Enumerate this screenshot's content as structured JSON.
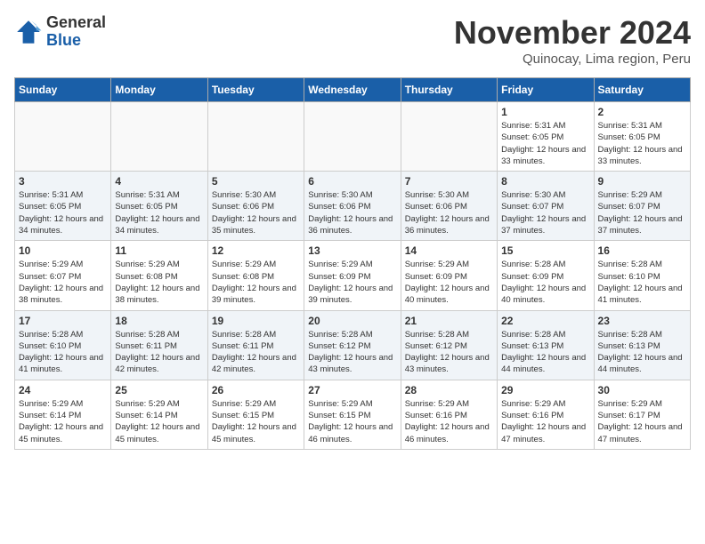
{
  "logo": {
    "general": "General",
    "blue": "Blue"
  },
  "header": {
    "month": "November 2024",
    "location": "Quinocay, Lima region, Peru"
  },
  "weekdays": [
    "Sunday",
    "Monday",
    "Tuesday",
    "Wednesday",
    "Thursday",
    "Friday",
    "Saturday"
  ],
  "weeks": [
    [
      {
        "day": "",
        "info": ""
      },
      {
        "day": "",
        "info": ""
      },
      {
        "day": "",
        "info": ""
      },
      {
        "day": "",
        "info": ""
      },
      {
        "day": "",
        "info": ""
      },
      {
        "day": "1",
        "info": "Sunrise: 5:31 AM\nSunset: 6:05 PM\nDaylight: 12 hours and 33 minutes."
      },
      {
        "day": "2",
        "info": "Sunrise: 5:31 AM\nSunset: 6:05 PM\nDaylight: 12 hours and 33 minutes."
      }
    ],
    [
      {
        "day": "3",
        "info": "Sunrise: 5:31 AM\nSunset: 6:05 PM\nDaylight: 12 hours and 34 minutes."
      },
      {
        "day": "4",
        "info": "Sunrise: 5:31 AM\nSunset: 6:05 PM\nDaylight: 12 hours and 34 minutes."
      },
      {
        "day": "5",
        "info": "Sunrise: 5:30 AM\nSunset: 6:06 PM\nDaylight: 12 hours and 35 minutes."
      },
      {
        "day": "6",
        "info": "Sunrise: 5:30 AM\nSunset: 6:06 PM\nDaylight: 12 hours and 36 minutes."
      },
      {
        "day": "7",
        "info": "Sunrise: 5:30 AM\nSunset: 6:06 PM\nDaylight: 12 hours and 36 minutes."
      },
      {
        "day": "8",
        "info": "Sunrise: 5:30 AM\nSunset: 6:07 PM\nDaylight: 12 hours and 37 minutes."
      },
      {
        "day": "9",
        "info": "Sunrise: 5:29 AM\nSunset: 6:07 PM\nDaylight: 12 hours and 37 minutes."
      }
    ],
    [
      {
        "day": "10",
        "info": "Sunrise: 5:29 AM\nSunset: 6:07 PM\nDaylight: 12 hours and 38 minutes."
      },
      {
        "day": "11",
        "info": "Sunrise: 5:29 AM\nSunset: 6:08 PM\nDaylight: 12 hours and 38 minutes."
      },
      {
        "day": "12",
        "info": "Sunrise: 5:29 AM\nSunset: 6:08 PM\nDaylight: 12 hours and 39 minutes."
      },
      {
        "day": "13",
        "info": "Sunrise: 5:29 AM\nSunset: 6:09 PM\nDaylight: 12 hours and 39 minutes."
      },
      {
        "day": "14",
        "info": "Sunrise: 5:29 AM\nSunset: 6:09 PM\nDaylight: 12 hours and 40 minutes."
      },
      {
        "day": "15",
        "info": "Sunrise: 5:28 AM\nSunset: 6:09 PM\nDaylight: 12 hours and 40 minutes."
      },
      {
        "day": "16",
        "info": "Sunrise: 5:28 AM\nSunset: 6:10 PM\nDaylight: 12 hours and 41 minutes."
      }
    ],
    [
      {
        "day": "17",
        "info": "Sunrise: 5:28 AM\nSunset: 6:10 PM\nDaylight: 12 hours and 41 minutes."
      },
      {
        "day": "18",
        "info": "Sunrise: 5:28 AM\nSunset: 6:11 PM\nDaylight: 12 hours and 42 minutes."
      },
      {
        "day": "19",
        "info": "Sunrise: 5:28 AM\nSunset: 6:11 PM\nDaylight: 12 hours and 42 minutes."
      },
      {
        "day": "20",
        "info": "Sunrise: 5:28 AM\nSunset: 6:12 PM\nDaylight: 12 hours and 43 minutes."
      },
      {
        "day": "21",
        "info": "Sunrise: 5:28 AM\nSunset: 6:12 PM\nDaylight: 12 hours and 43 minutes."
      },
      {
        "day": "22",
        "info": "Sunrise: 5:28 AM\nSunset: 6:13 PM\nDaylight: 12 hours and 44 minutes."
      },
      {
        "day": "23",
        "info": "Sunrise: 5:28 AM\nSunset: 6:13 PM\nDaylight: 12 hours and 44 minutes."
      }
    ],
    [
      {
        "day": "24",
        "info": "Sunrise: 5:29 AM\nSunset: 6:14 PM\nDaylight: 12 hours and 45 minutes."
      },
      {
        "day": "25",
        "info": "Sunrise: 5:29 AM\nSunset: 6:14 PM\nDaylight: 12 hours and 45 minutes."
      },
      {
        "day": "26",
        "info": "Sunrise: 5:29 AM\nSunset: 6:15 PM\nDaylight: 12 hours and 45 minutes."
      },
      {
        "day": "27",
        "info": "Sunrise: 5:29 AM\nSunset: 6:15 PM\nDaylight: 12 hours and 46 minutes."
      },
      {
        "day": "28",
        "info": "Sunrise: 5:29 AM\nSunset: 6:16 PM\nDaylight: 12 hours and 46 minutes."
      },
      {
        "day": "29",
        "info": "Sunrise: 5:29 AM\nSunset: 6:16 PM\nDaylight: 12 hours and 47 minutes."
      },
      {
        "day": "30",
        "info": "Sunrise: 5:29 AM\nSunset: 6:17 PM\nDaylight: 12 hours and 47 minutes."
      }
    ]
  ]
}
